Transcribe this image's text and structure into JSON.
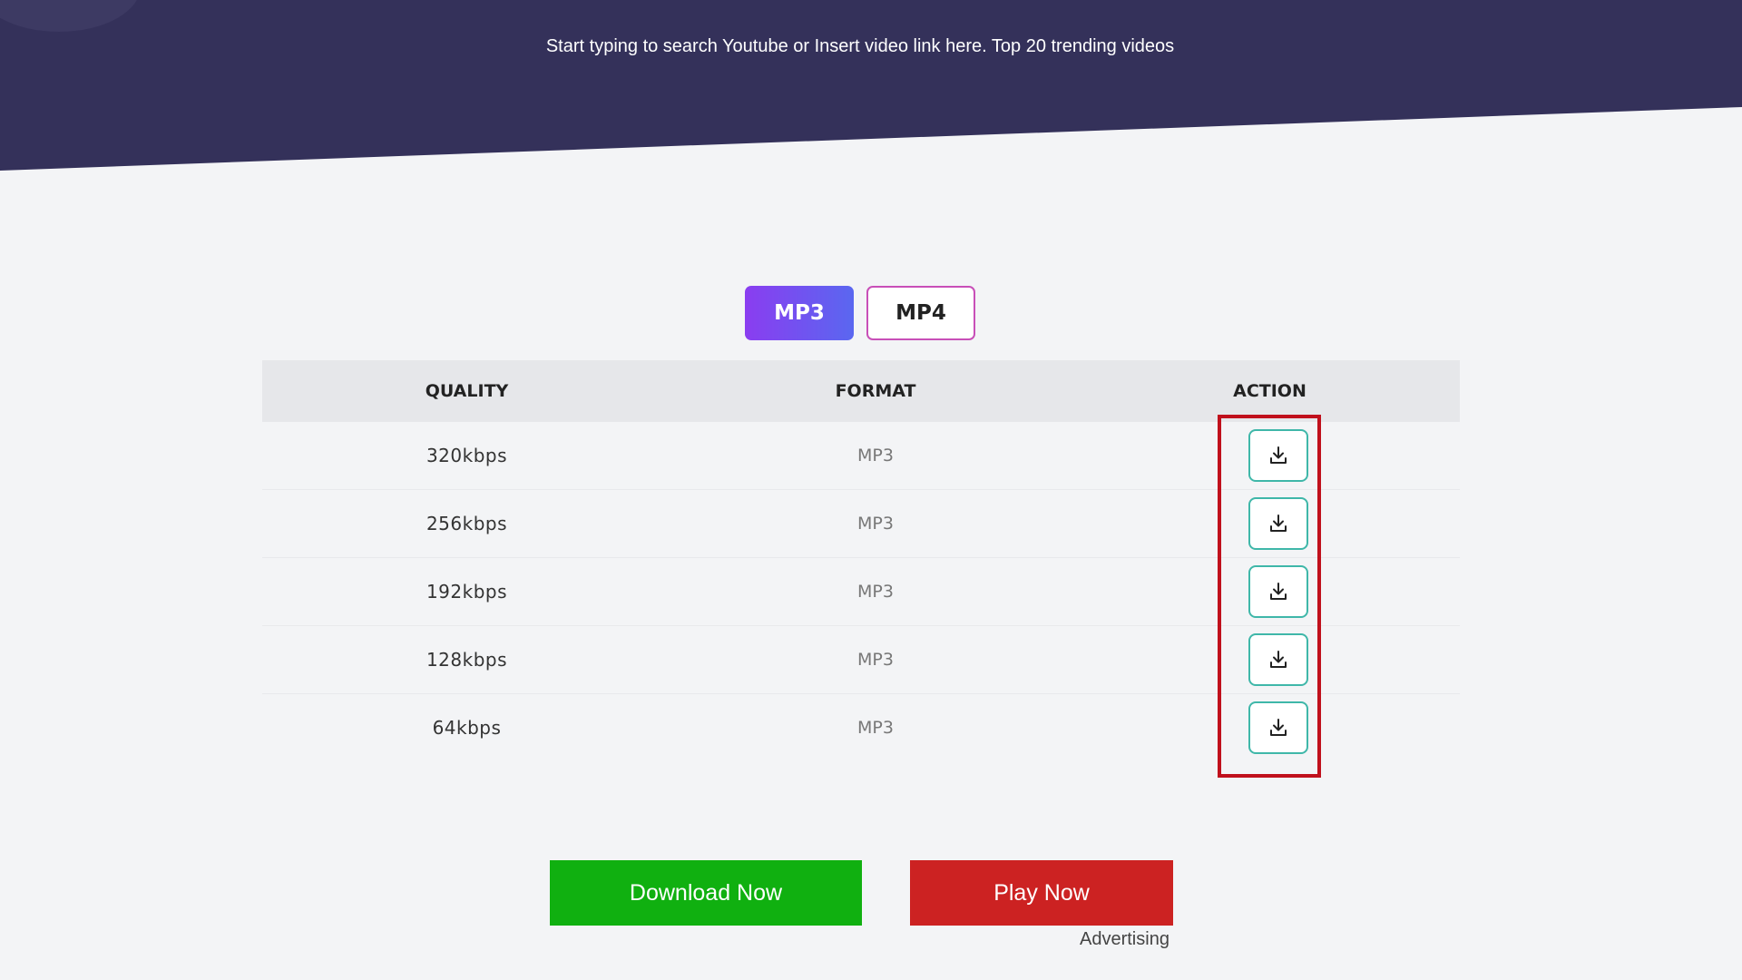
{
  "header": {
    "hint_text": "Start typing to search Youtube or Insert video link here. Top 20 trending videos"
  },
  "format_tabs": [
    {
      "label": "MP3",
      "active": true
    },
    {
      "label": "MP4",
      "active": false
    }
  ],
  "table": {
    "columns": [
      "QUALITY",
      "FORMAT",
      "ACTION"
    ],
    "rows": [
      {
        "quality": "320kbps",
        "format": "MP3",
        "action_icon": "download-icon"
      },
      {
        "quality": "256kbps",
        "format": "MP3",
        "action_icon": "download-icon"
      },
      {
        "quality": "192kbps",
        "format": "MP3",
        "action_icon": "download-icon"
      },
      {
        "quality": "128kbps",
        "format": "MP3",
        "action_icon": "download-icon"
      },
      {
        "quality": "64kbps",
        "format": "MP3",
        "action_icon": "download-icon"
      }
    ]
  },
  "ad": {
    "download_label": "Download Now",
    "play_label": "Play Now",
    "advertising_label": "Advertising"
  },
  "colors": {
    "header_bg": "#34315a",
    "page_bg": "#f3f4f6",
    "tab_active_gradient": [
      "#8a3df0",
      "#5a67f0"
    ],
    "tab_inactive_border": "#c84fb8",
    "download_btn_border": "#3fb7a9",
    "highlight_box": "#c0101c",
    "download_now_bg": "#10b010",
    "play_now_bg": "#cc2222"
  }
}
